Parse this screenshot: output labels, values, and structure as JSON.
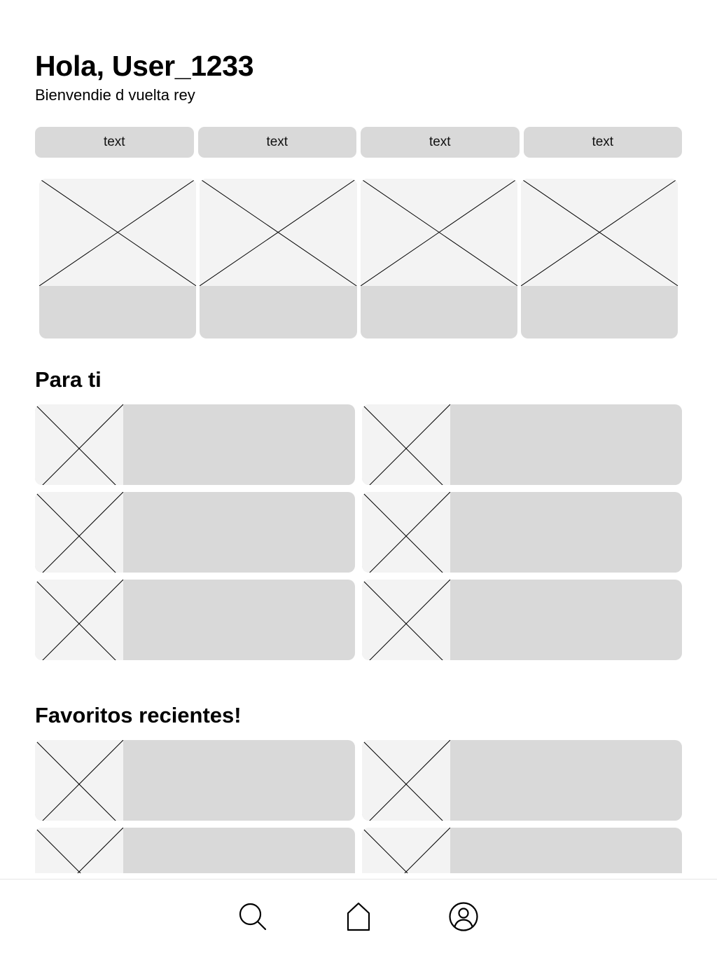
{
  "header": {
    "greeting": "Hola, User_1233",
    "subtitle": "Bienvendie d vuelta rey"
  },
  "chips": [
    {
      "label": "text"
    },
    {
      "label": "text"
    },
    {
      "label": "text"
    },
    {
      "label": "text"
    }
  ],
  "sections": {
    "for_you_title": "Para ti",
    "favorites_title": "Favoritos recientes!"
  },
  "nav": {
    "icons": [
      "search-icon",
      "home-icon",
      "profile-icon"
    ]
  }
}
